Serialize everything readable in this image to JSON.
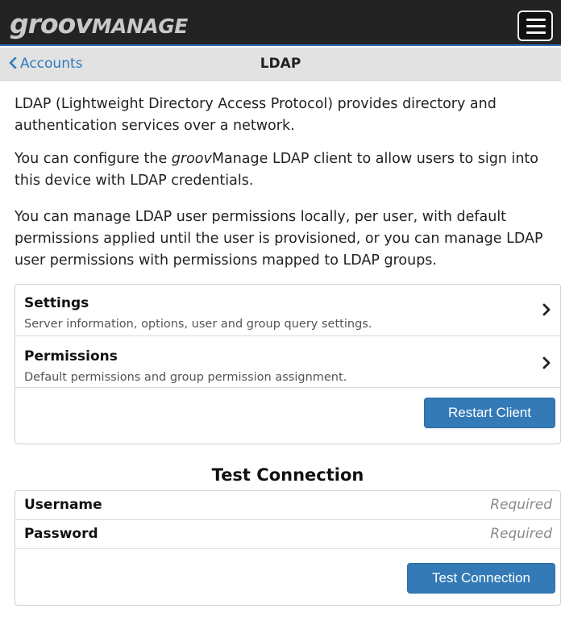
{
  "header": {
    "logo_groov": "groov",
    "logo_manage": "MANAGE",
    "menu_icon": "hamburger-menu-icon"
  },
  "subheader": {
    "back_icon": "chevron-left-icon",
    "back_label": "Accounts",
    "title": "LDAP"
  },
  "intro": {
    "p1": "LDAP (Lightweight Directory Access Protocol) provides directory and authentication services over a network.",
    "p2_before": "You can configure the ",
    "p2_brand": "groov",
    "p2_after": "Manage LDAP client to allow users to sign into this device with LDAP credentials.",
    "p3": "You can manage LDAP user permissions locally, per user, with default permissions applied until the user is provisioned, or you can manage LDAP user permissions with permissions mapped to LDAP groups."
  },
  "nav_list": [
    {
      "title": "Settings",
      "subtitle": "Server information, options, user and group query settings.",
      "icon": "chevron-right-icon"
    },
    {
      "title": "Permissions",
      "subtitle": "Default permissions and group permission assignment.",
      "icon": "chevron-right-icon"
    }
  ],
  "restart_button": "Restart Client",
  "test_connection": {
    "title": "Test Connection",
    "username_label": "Username",
    "username_placeholder": "Required",
    "username_value": "",
    "password_label": "Password",
    "password_placeholder": "Required",
    "password_value": "",
    "button": "Test Connection"
  },
  "colors": {
    "topbar": "#232323",
    "accent": "#337ab7",
    "link": "#2f7abf",
    "subbar": "#e2e2e2"
  }
}
